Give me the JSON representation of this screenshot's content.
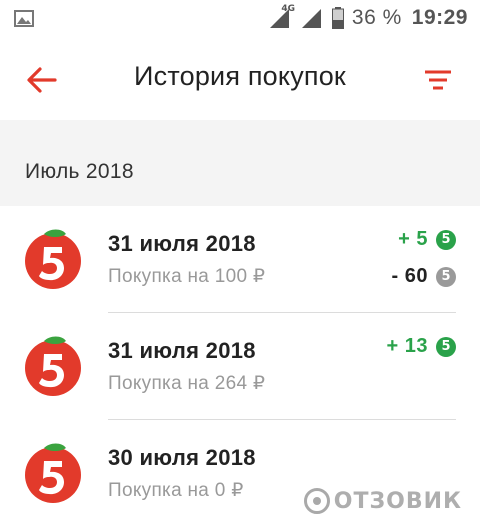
{
  "status_bar": {
    "network_label": "4G",
    "battery_percent": "36 %",
    "time": "19:29",
    "icons": [
      "gallery-icon",
      "signal-icon",
      "signal-icon",
      "battery-icon"
    ]
  },
  "app_bar": {
    "title": "История покупок",
    "back_icon": "arrow-left-icon",
    "filter_icon": "filter-icon"
  },
  "colors": {
    "accent": "#e23a2b",
    "positive": "#2aa24a",
    "muted": "#999999",
    "section_bg": "#f4f4f4"
  },
  "section": {
    "title": "Июль 2018"
  },
  "purchases": [
    {
      "date": "31 июля 2018",
      "subtitle": "Покупка на 100 ₽",
      "points_earned": "+ 5",
      "points_spent": "- 60",
      "coin_symbol": "5"
    },
    {
      "date": "31 июля 2018",
      "subtitle": "Покупка на 264 ₽",
      "points_earned": "+ 13",
      "coin_symbol": "5"
    },
    {
      "date": "30 июля 2018",
      "subtitle": "Покупка на 0 ₽",
      "coin_symbol": "5"
    }
  ],
  "watermark": {
    "text": "ОТЗОВИК"
  }
}
